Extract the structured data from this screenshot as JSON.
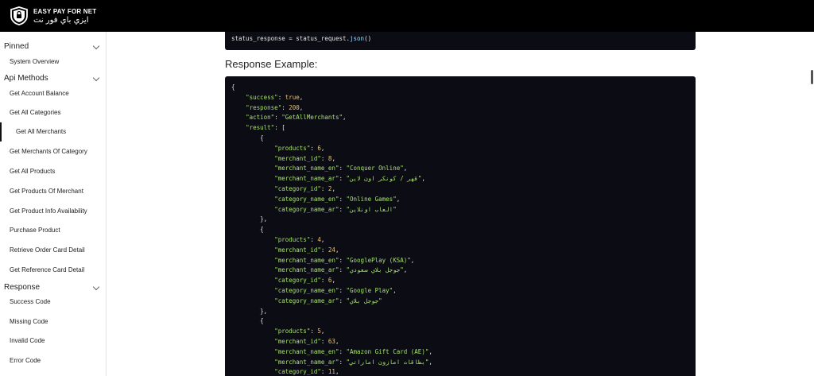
{
  "brand": {
    "name_en": "EASY PAY FOR NET",
    "name_ar": "ايزي باي فور نت"
  },
  "sidebar": {
    "sections": [
      {
        "title": "Pinned",
        "items": [
          "System Overview"
        ]
      },
      {
        "title": "Api Methods",
        "items": [
          "Get Account Balance",
          "Get All Categories",
          "Get All Merchants",
          "Get Merchants Of Category",
          "Get All Products",
          "Get Products Of Merchant",
          "Get Product Info Availability",
          "Purchase Product",
          "Retrieve Order Card Detail",
          "Get Reference Card Detail"
        ]
      },
      {
        "title": "Response",
        "items": [
          "Success Code",
          "Missing Code",
          "Invalid Code",
          "Error Code"
        ]
      }
    ],
    "active_item": "Get All Merchants"
  },
  "main": {
    "top_code": {
      "var": "status_response",
      "op": " = ",
      "obj": "status_request.",
      "fn": "json",
      "tail": "()"
    },
    "heading": "Response Example:",
    "response": {
      "success": "true",
      "response": "200",
      "action": "\"GetAllMerchants\"",
      "result": [
        {
          "products": "6",
          "merchant_id": "8",
          "merchant_name_en": "\"Conquer Online\"",
          "merchant_name_ar": "\"قهر / كونكر اون لاين\"",
          "category_id": "2",
          "category_name_en": "\"Online Games\"",
          "category_name_ar": "\"العاب اونلاين\""
        },
        {
          "products": "4",
          "merchant_id": "24",
          "merchant_name_en": "\"GooglePlay (KSA)\"",
          "merchant_name_ar": "\"جوجل بلاي سعودي\"",
          "category_id": "6",
          "category_name_en": "\"Google Play\"",
          "category_name_ar": "\"جوجل بلاي\""
        },
        {
          "products": "5",
          "merchant_id": "63",
          "merchant_name_en": "\"Amazon Gift Card (AE)\"",
          "merchant_name_ar": "\"بطاقات امازون اماراتي\"",
          "category_id": "11"
        }
      ]
    }
  }
}
